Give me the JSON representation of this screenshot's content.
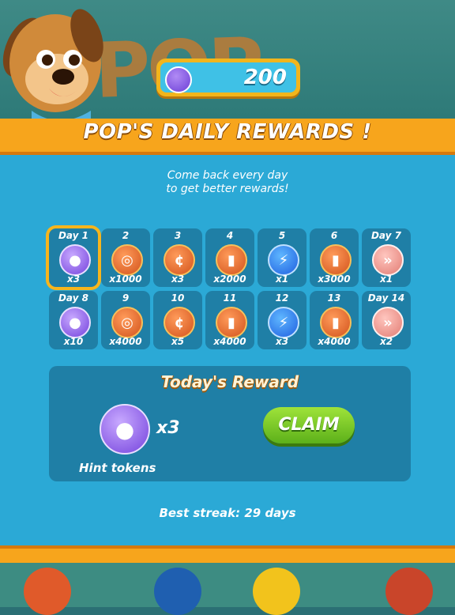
{
  "counter": {
    "icon": "hint-token-icon",
    "value": "200"
  },
  "header": {
    "title": "POP'S DAILY REWARDS !"
  },
  "subtitle": {
    "line1": "Come back every day",
    "line2": "to get better rewards!"
  },
  "rewards": [
    {
      "day": "Day 1",
      "qty": "x3",
      "icon": "hint"
    },
    {
      "day": "2",
      "qty": "x1000",
      "icon": "coins"
    },
    {
      "day": "3",
      "qty": "x3",
      "icon": "coin"
    },
    {
      "day": "4",
      "qty": "x2000",
      "icon": "coin-stack"
    },
    {
      "day": "5",
      "qty": "x1",
      "icon": "bolt"
    },
    {
      "day": "6",
      "qty": "x3000",
      "icon": "coin-stack"
    },
    {
      "day": "Day 7",
      "qty": "x1",
      "icon": "fast-forward"
    },
    {
      "day": "Day 8",
      "qty": "x10",
      "icon": "hint"
    },
    {
      "day": "9",
      "qty": "x4000",
      "icon": "coins"
    },
    {
      "day": "10",
      "qty": "x5",
      "icon": "coin"
    },
    {
      "day": "11",
      "qty": "x4000",
      "icon": "coin-stack"
    },
    {
      "day": "12",
      "qty": "x3",
      "icon": "bolt"
    },
    {
      "day": "13",
      "qty": "x4000",
      "icon": "coin-stack"
    },
    {
      "day": "Day 14",
      "qty": "x2",
      "icon": "fast-forward"
    }
  ],
  "today": {
    "title": "Today's Reward",
    "qty": "x3",
    "name": "Hint tokens",
    "claim_label": "CLAIM"
  },
  "streak": "Best streak: 29 days",
  "colors": {
    "panel": "#2ba9d6",
    "header": "#f7a51c",
    "claim": "#7ccc2a"
  }
}
